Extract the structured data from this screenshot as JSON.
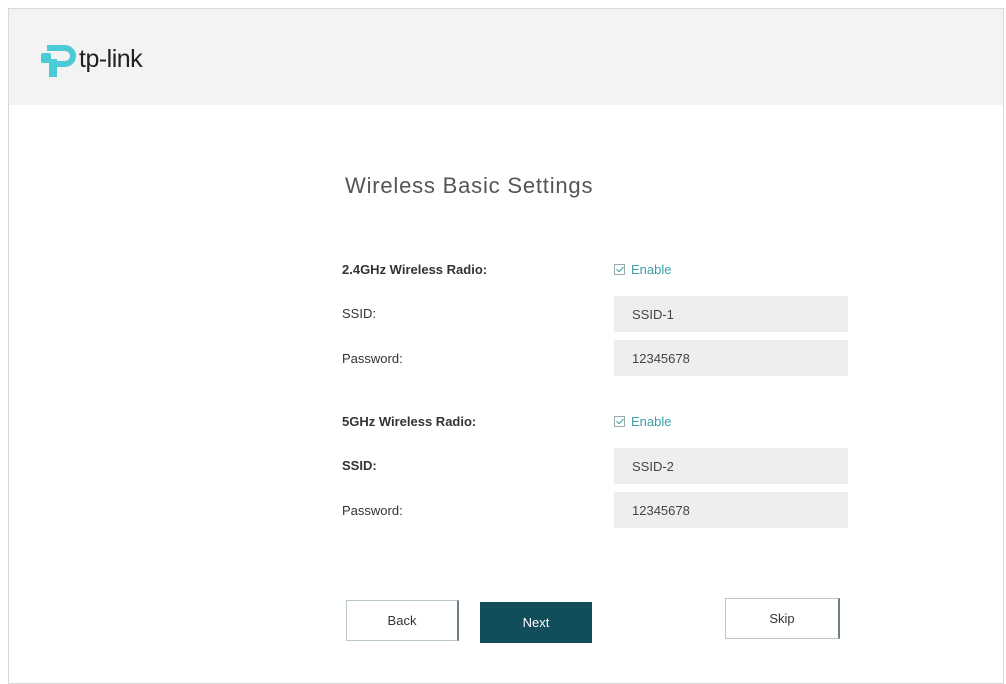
{
  "header": {
    "logo_text": "tp-link"
  },
  "page": {
    "title": "Wireless Basic Settings"
  },
  "band_24": {
    "radio_label": "2.4GHz Wireless Radio:",
    "enable_label": "Enable",
    "enabled": true,
    "ssid_label": "SSID:",
    "ssid_value": "SSID-1",
    "password_label": "Password:",
    "password_value": "12345678"
  },
  "band_5": {
    "radio_label": "5GHz Wireless Radio:",
    "enable_label": "Enable",
    "enabled": true,
    "ssid_label": "SSID:",
    "ssid_value": "SSID-2",
    "password_label": "Password:",
    "password_value": "12345678"
  },
  "buttons": {
    "back_label": "Back",
    "next_label": "Next",
    "skip_label": "Skip"
  },
  "colors": {
    "brand_teal": "#4acbd6",
    "next_button": "#124d5c",
    "enable_text": "#3aa0a8",
    "header_bg": "#f3f3f3"
  },
  "icons": {
    "logo": "tp-link-logo-icon",
    "checkbox": "checkbox-checked-icon"
  }
}
